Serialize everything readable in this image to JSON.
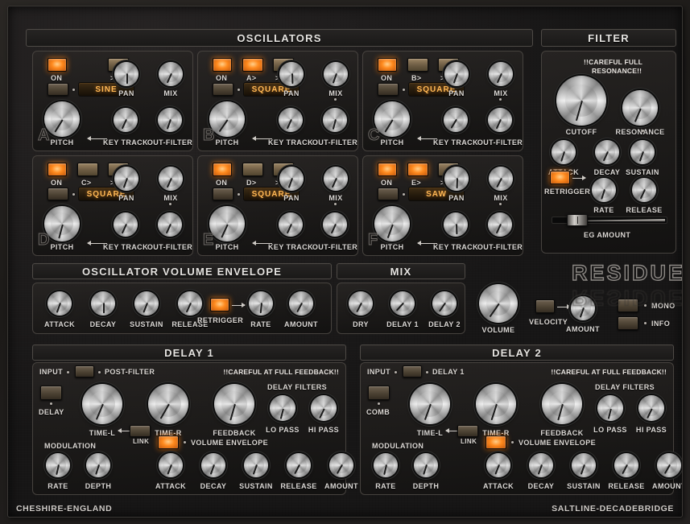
{
  "app": {
    "name": "RESIDUE",
    "brand_left": "CHESHIRE-ENGLAND",
    "brand_right": "SALTLINE-DECADEBRIDGE"
  },
  "sections": {
    "oscillators": "OSCILLATORS",
    "filter": "FILTER",
    "osc_volume_envelope": "OSCILLATOR VOLUME ENVELOPE",
    "mix": "MIX",
    "delay1": "DELAY 1",
    "delay2": "DELAY 2"
  },
  "osc_labels": {
    "on": "ON",
    "sync": ">|<",
    "pitch": "PITCH",
    "key_track": "KEY TRACK",
    "out_filter": "OUT-FILTER",
    "pan": "PAN",
    "mix": "MIX"
  },
  "oscillators": [
    {
      "letter": "A",
      "on": true,
      "fm_label": "",
      "fm_on": false,
      "sync_on": false,
      "wave": "SINE",
      "pitch": 212,
      "keytrack": 205,
      "outfilter": 200,
      "pan": 180,
      "mix": 205,
      "mix_dot": false
    },
    {
      "letter": "B",
      "on": true,
      "fm_label": "A>",
      "fm_on": true,
      "sync_on": false,
      "wave": "SQUARE",
      "pitch": 215,
      "keytrack": 205,
      "outfilter": 195,
      "pan": 178,
      "mix": 200,
      "mix_dot": true
    },
    {
      "letter": "C",
      "on": true,
      "fm_label": "B>",
      "fm_on": false,
      "sync_on": false,
      "wave": "SQUARE",
      "pitch": 212,
      "keytrack": 212,
      "outfilter": 205,
      "pan": 200,
      "mix": 205,
      "mix_dot": true
    },
    {
      "letter": "D",
      "on": true,
      "fm_label": "C>",
      "fm_on": false,
      "sync_on": false,
      "wave": "SQUARE",
      "pitch": 195,
      "keytrack": 205,
      "outfilter": 205,
      "pan": 200,
      "mix": 205,
      "mix_dot": true
    },
    {
      "letter": "E",
      "on": true,
      "fm_label": "D>",
      "fm_on": false,
      "sync_on": false,
      "wave": "SQUARE",
      "pitch": 205,
      "keytrack": 205,
      "outfilter": 205,
      "pan": 200,
      "mix": 205,
      "mix_dot": true
    },
    {
      "letter": "F",
      "on": true,
      "fm_label": "E>",
      "fm_on": true,
      "sync_on": false,
      "wave": "SAW",
      "pitch": 200,
      "keytrack": 178,
      "outfilter": 205,
      "pan": 182,
      "mix": 208,
      "mix_dot": true
    }
  ],
  "filter": {
    "warning": "!!CAREFUL FULL\nRESONANCE!!",
    "warning_line1": "!!CAREFUL FULL",
    "warning_line2": "RESONANCE!!",
    "cutoff": {
      "label": "CUTOFF",
      "angle": 196
    },
    "resonance": {
      "label": "RESONANCE",
      "angle": 203
    },
    "attack": {
      "label": "ATTACK",
      "angle": 198
    },
    "decay": {
      "label": "DECAY",
      "angle": 205
    },
    "sustain": {
      "label": "SUSTAIN",
      "angle": 200
    },
    "retrigger": {
      "label": "RETRIGGER",
      "on": true
    },
    "rate": {
      "label": "RATE",
      "angle": 198
    },
    "release": {
      "label": "RELEASE",
      "angle": 205
    },
    "eg_amount": {
      "label": "EG AMOUNT",
      "handle_pct": 18
    },
    "sustain_dot": true
  },
  "osc_envelope": {
    "knobs": [
      {
        "label": "ATTACK",
        "angle": 200
      },
      {
        "label": "DECAY",
        "angle": 180
      },
      {
        "label": "SUSTAIN",
        "angle": 202
      },
      {
        "label": "RELEASE",
        "angle": 205
      }
    ],
    "retrigger": {
      "label": "RETRIGGER",
      "on": true
    },
    "rate": {
      "label": "RATE",
      "angle": 186
    },
    "amount": {
      "label": "AMOUNT",
      "angle": 208
    }
  },
  "mix_section": {
    "knobs": [
      {
        "label": "DRY",
        "angle": 208
      },
      {
        "label": "DELAY 1",
        "angle": 222
      },
      {
        "label": "DELAY 2",
        "angle": 215
      }
    ]
  },
  "master": {
    "volume": {
      "label": "VOLUME",
      "angle": 215
    },
    "velocity": {
      "label": "VELOCITY",
      "on": false
    },
    "amount": {
      "label": "AMOUNT",
      "angle": 200
    },
    "mono": {
      "label": "MONO",
      "on": false
    },
    "info": {
      "label": "INFO",
      "on": false
    }
  },
  "delays": [
    {
      "title": "DELAY 1",
      "input_label": "INPUT",
      "source_label": "POST-FILTER",
      "mode_button_label": "DELAY",
      "mode_on": false,
      "input_on": false,
      "warning": "!!CAREFUL AT FULL FEEDBACK!!",
      "time_l": {
        "label": "TIME-L",
        "angle": 203
      },
      "time_r": {
        "label": "TIME-R",
        "angle": 210
      },
      "feedback": {
        "label": "FEEDBACK",
        "angle": 196
      },
      "link": {
        "label": "LINK",
        "on": false
      },
      "filters_label": "DELAY FILTERS",
      "lopass": {
        "label": "LO PASS",
        "angle": 194
      },
      "hipass": {
        "label": "HI PASS",
        "angle": 206
      },
      "modulation_label": "MODULATION",
      "rate": {
        "label": "RATE",
        "angle": 193
      },
      "depth": {
        "label": "DEPTH",
        "angle": 198
      },
      "volume_envelope": {
        "label": "VOLUME ENVELOPE",
        "on": true
      },
      "env": [
        {
          "label": "ATTACK",
          "angle": 202
        },
        {
          "label": "DECAY",
          "angle": 200
        },
        {
          "label": "SUSTAIN",
          "angle": 200
        },
        {
          "label": "RELEASE",
          "angle": 208
        },
        {
          "label": "AMOUNT",
          "angle": 210
        }
      ]
    },
    {
      "title": "DELAY 2",
      "input_label": "INPUT",
      "source_label": "DELAY 1",
      "mode_button_label": "COMB",
      "mode_on": false,
      "input_on": false,
      "warning": "!!CAREFUL AT FULL FEEDBACK!!",
      "time_l": {
        "label": "TIME-L",
        "angle": 200
      },
      "time_r": {
        "label": "TIME-R",
        "angle": 198
      },
      "feedback": {
        "label": "FEEDBACK",
        "angle": 196
      },
      "link": {
        "label": "LINK",
        "on": false
      },
      "filters_label": "DELAY FILTERS",
      "lopass": {
        "label": "LO PASS",
        "angle": 194
      },
      "hipass": {
        "label": "HI PASS",
        "angle": 206
      },
      "modulation_label": "MODULATION",
      "rate": {
        "label": "RATE",
        "angle": 193
      },
      "depth": {
        "label": "DEPTH",
        "angle": 198
      },
      "volume_envelope": {
        "label": "VOLUME ENVELOPE",
        "on": true
      },
      "env": [
        {
          "label": "ATTACK",
          "angle": 202
        },
        {
          "label": "DECAY",
          "angle": 200
        },
        {
          "label": "SUSTAIN",
          "angle": 200
        },
        {
          "label": "RELEASE",
          "angle": 208
        },
        {
          "label": "AMOUNT",
          "angle": 210
        }
      ]
    }
  ],
  "colors": {
    "accent": "#e8661a",
    "lamp_on": "#ff8a1e",
    "panel": "#1a1918",
    "text": "#ddd9d5",
    "wave_text": "#ffb855"
  }
}
